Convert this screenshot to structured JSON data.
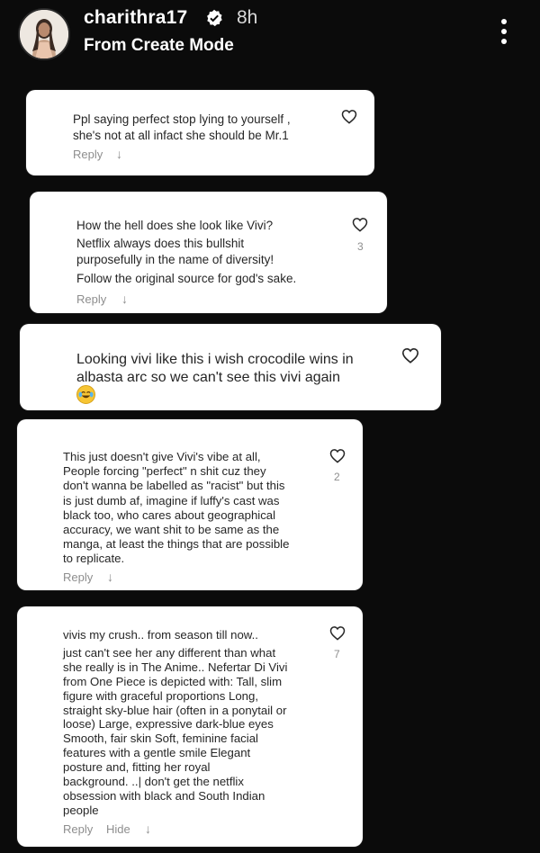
{
  "header": {
    "username": "charithra17",
    "time_ago": "8h",
    "subtitle": "From Create Mode"
  },
  "icons": {
    "verified": "verified-badge-icon",
    "more": "more-vertical-icon",
    "like": "heart-outline-icon",
    "reply_arrow": "arrow-down-icon",
    "emoji": "tears-of-joy-emoji"
  },
  "comments": [
    {
      "lines": [
        "Ppl saying perfect stop lying to yourself ,",
        "she's not at all infact she should be Mr.1"
      ],
      "reply_label": "Reply",
      "arrow": "↓"
    },
    {
      "lines": [
        "How the hell does she look like Vivi?",
        "Netflix always does this bullshit",
        "purposefully in the name of diversity!",
        "Follow the original source for god's sake."
      ],
      "likes": "3",
      "reply_label": "Reply",
      "arrow": "↓"
    },
    {
      "lines": [
        "Looking vivi like this i wish crocodile wins in",
        "albasta arc so we can't  see this vivi again"
      ],
      "emoji": "😂"
    },
    {
      "lines": [
        "This just doesn't give Vivi's vibe at all,",
        "People forcing \"perfect\" n shit cuz they",
        "don't wanna be labelled as \"racist\" but this",
        "is just dumb af, imagine if luffy's cast was",
        "black too, who cares about geographical",
        "accuracy, we want shit to be same as the",
        "manga, at least the things that are possible",
        "to replicate."
      ],
      "likes": "2",
      "reply_label": "Reply",
      "arrow": "↓"
    },
    {
      "lines": [
        "vivis my crush.. from season till now..",
        "just can't see her any different than what",
        "she really is in The Anime.. Nefertar Di Vivi",
        "from One Piece is depicted with: Tall, slim",
        "figure with graceful proportions Long,",
        "straight sky-blue hair (often in a ponytail or",
        "loose) Large, expressive dark-blue eyes",
        "Smooth, fair skin Soft, feminine facial",
        "features with a gentle smile Elegant",
        "posture and, fitting her royal",
        "background. ..| don't get the netflix",
        "obsession with black and South Indian",
        "people"
      ],
      "likes": "7",
      "reply_label": "Reply",
      "hide_label": "Hide",
      "arrow": "↓"
    }
  ]
}
